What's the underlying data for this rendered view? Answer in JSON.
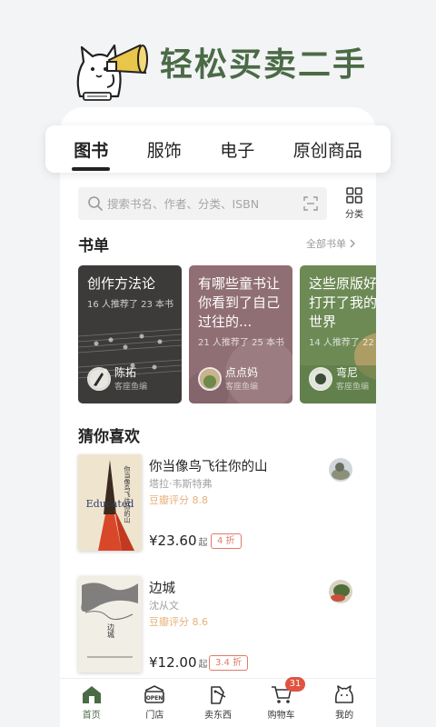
{
  "hero": {
    "title": "轻松买卖二手"
  },
  "tabs": [
    {
      "label": "图书",
      "active": true
    },
    {
      "label": "服饰",
      "active": false
    },
    {
      "label": "电子",
      "active": false
    },
    {
      "label": "原创商品",
      "active": false
    }
  ],
  "search": {
    "placeholder": "搜索书名、作者、分类、ISBN",
    "category_label": "分类"
  },
  "booklist_section": {
    "title": "书单",
    "more_label": "全部书单"
  },
  "booklists": [
    {
      "title": "创作方法论",
      "subtitle": "16 人推荐了 23 本书",
      "author": "陈拓",
      "role": "客座鱼编",
      "color": "#3d3b3a"
    },
    {
      "title": "有哪些童书让你看到了自己过往的...",
      "subtitle": "21 人推荐了 25 本书",
      "author": "点点妈",
      "role": "客座鱼编",
      "color": "#8f6e74"
    },
    {
      "title": "这些原版好书打开了我的新世界",
      "subtitle": "14 人推荐了 22",
      "author": "弯尼",
      "role": "客座鱼编",
      "color": "#6d8a55"
    }
  ],
  "rec_section": {
    "title": "猜你喜欢"
  },
  "recommendations": [
    {
      "title": "你当像鸟飞往你的山",
      "author": "塔拉·韦斯特弗",
      "rating": "豆瓣评分 8.8",
      "price": "¥23.60",
      "price_suffix": "起",
      "discount": "4 折",
      "cover_text": "你当像鸟飞往你的山",
      "cover_word": "Educated"
    },
    {
      "title": "边城",
      "author": "沈从文",
      "rating": "豆瓣评分 8.6",
      "price": "¥12.00",
      "price_suffix": "起",
      "discount": "3.4 折",
      "cover_text": "边城"
    }
  ],
  "bottom_nav": [
    {
      "label": "首页",
      "icon": "home-icon",
      "active": true
    },
    {
      "label": "门店",
      "icon": "store-icon",
      "active": false
    },
    {
      "label": "卖东西",
      "icon": "sell-icon",
      "active": false
    },
    {
      "label": "购物车",
      "icon": "cart-icon",
      "active": false,
      "badge": "31"
    },
    {
      "label": "我的",
      "icon": "profile-icon",
      "active": false
    }
  ],
  "store_sign": "OPEN",
  "colors": {
    "brand": "#4b6b46",
    "accent": "#e0533f",
    "rating": "#e6b07a"
  }
}
